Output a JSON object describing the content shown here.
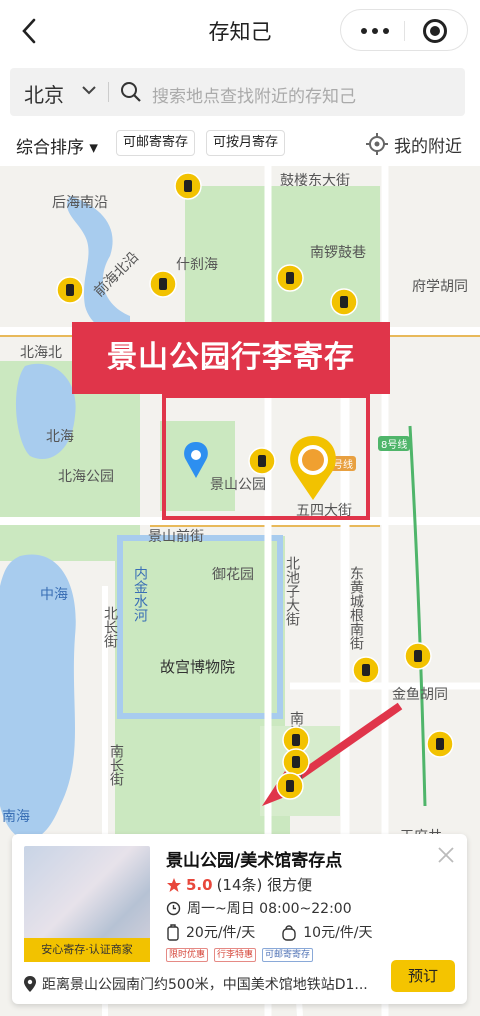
{
  "header": {
    "title": "存知己",
    "back_icon": "chevron-left-icon"
  },
  "search": {
    "city": "北京",
    "placeholder": "搜索地点查找附近的存知己"
  },
  "filters": {
    "sort_label": "综合排序 ▾",
    "tags": [
      "可邮寄寄存",
      "可按月寄存"
    ],
    "nearby_label": "我的附近"
  },
  "map": {
    "labels": [
      "后海南沿",
      "前海北沿",
      "什刹海",
      "北海北",
      "北海",
      "北海公园",
      "南锣鼓巷",
      "府学胡同",
      "景山公园",
      "景山前街",
      "御花园",
      "北池子大街",
      "东黄城根南街",
      "内金水河",
      "北长街",
      "故宫博物院",
      "中海",
      "南海",
      "南长街",
      "南池子大街",
      "金鱼胡同",
      "王府井",
      "鼓楼东大街",
      "五四大街",
      "8号线",
      "号线"
    ],
    "banner": "景山公园行李寄存"
  },
  "card": {
    "name": "景山公园/美术馆寄存点",
    "rating": "5.0",
    "reviews": "(14条) 很方便",
    "hours": "周一~周日 08:00~22:00",
    "price_piece": "20元/件/天",
    "price_luggage": "10元/件/天",
    "badge": "安心寄存·认证商家",
    "mini_tags": [
      "限时优惠",
      "行李特惠",
      "可邮寄寄存"
    ],
    "address": "距离景山公园南门约500米，中国美术馆地铁站D1...",
    "order_label": "预订"
  },
  "colors": {
    "accent": "#f4c400",
    "banner": "#e0354a",
    "park": "#cbe8c0",
    "water": "#a8ccee",
    "pin_blue": "#2d8ff0"
  }
}
